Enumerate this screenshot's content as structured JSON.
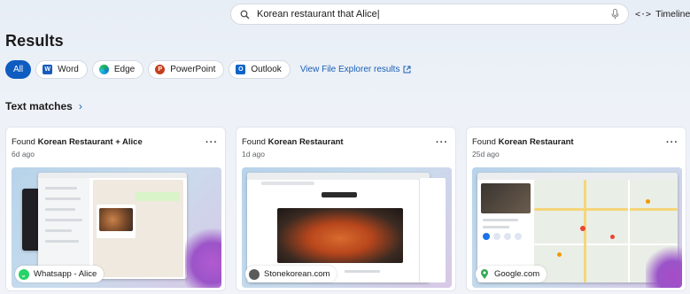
{
  "search": {
    "value": "Korean restaurant that Alice|"
  },
  "timeline": {
    "label": "Timeline"
  },
  "page": {
    "title": "Results"
  },
  "filters": [
    {
      "label": "All",
      "active": true
    },
    {
      "label": "Word",
      "icon": "word-icon"
    },
    {
      "label": "Edge",
      "icon": "edge-icon"
    },
    {
      "label": "PowerPoint",
      "icon": "powerpoint-icon"
    },
    {
      "label": "Outlook",
      "icon": "outlook-icon"
    }
  ],
  "file_explorer_link": "View File Explorer results",
  "section": {
    "title": "Text matches"
  },
  "cards": [
    {
      "found_prefix": "Found ",
      "found_match": "Korean Restaurant + Alice",
      "age": "6d ago",
      "source": "Whatsapp - Alice",
      "source_icon": "whatsapp-icon",
      "accent": "#25d366"
    },
    {
      "found_prefix": "Found ",
      "found_match": "Korean Restaurant",
      "age": "1d ago",
      "source": "Stonekorean.com",
      "source_icon": "stonekorean-icon",
      "accent": "#5a5a5a"
    },
    {
      "found_prefix": "Found ",
      "found_match": "Korean Restaurant",
      "age": "25d ago",
      "source": "Google.com",
      "source_icon": "google-maps-icon",
      "accent": "#34a853"
    }
  ],
  "colors": {
    "accent": "#0f5cc0",
    "link": "#1a5fb4"
  }
}
